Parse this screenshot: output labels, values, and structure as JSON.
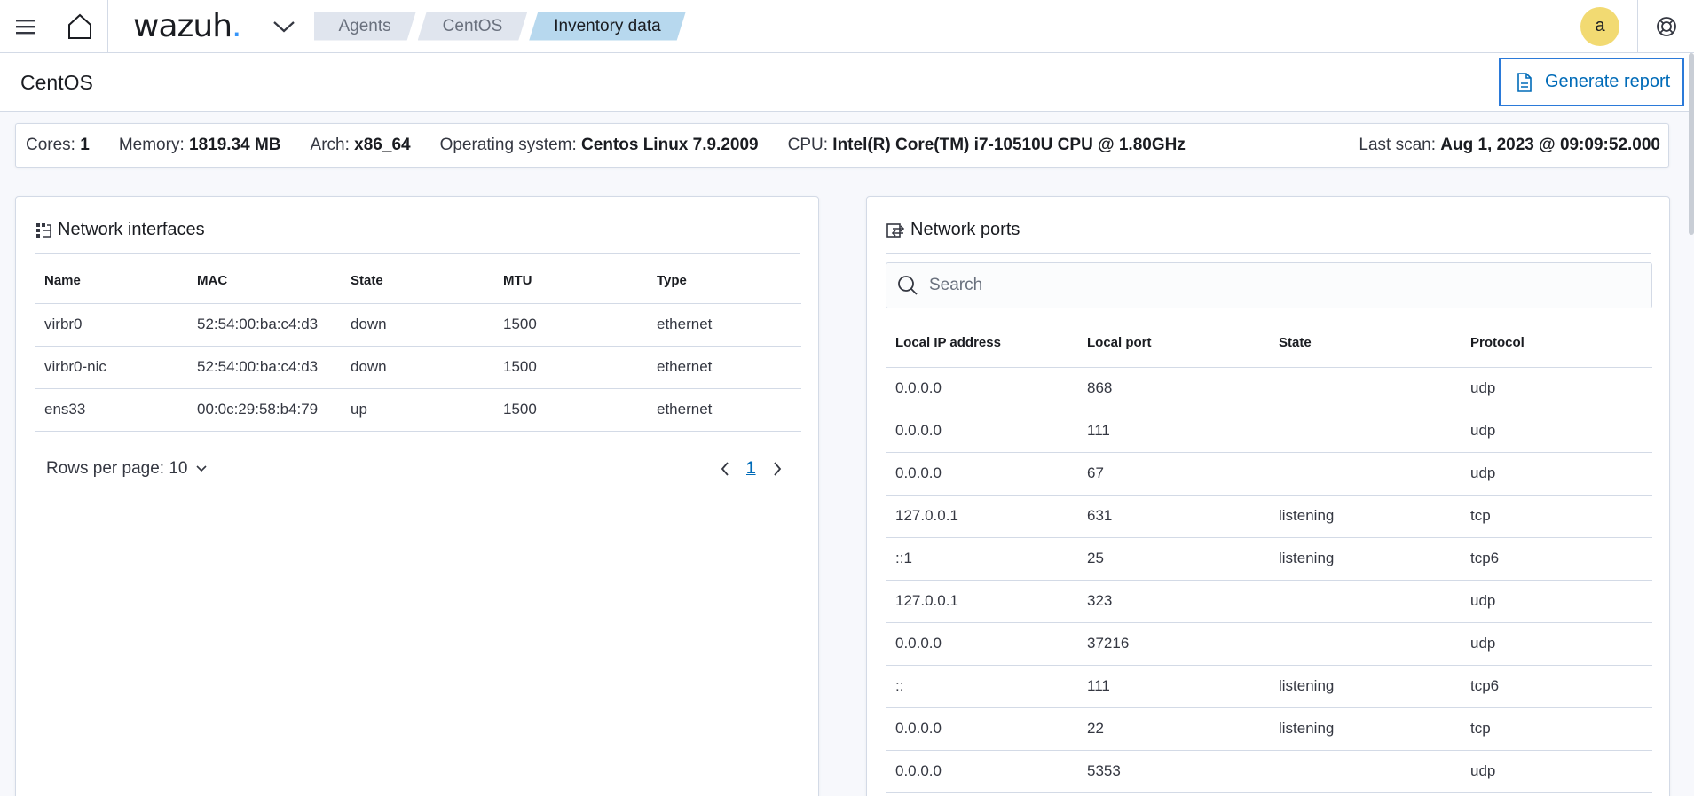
{
  "header": {
    "logo_text": "wazuh",
    "logo_dot": ".",
    "breadcrumbs": [
      "Agents",
      "CentOS",
      "Inventory data"
    ],
    "avatar_letter": "a"
  },
  "titlebar": {
    "title": "CentOS",
    "report_label": "Generate report"
  },
  "info": {
    "cores_label": "Cores:",
    "cores": "1",
    "memory_label": "Memory:",
    "memory": "1819.34 MB",
    "arch_label": "Arch:",
    "arch": "x86_64",
    "os_label": "Operating system:",
    "os": "Centos Linux 7.9.2009",
    "cpu_label": "CPU:",
    "cpu": "Intel(R) Core(TM) i7-10510U CPU @ 1.80GHz",
    "scan_label": "Last scan:",
    "scan": "Aug 1, 2023 @ 09:09:52.000"
  },
  "interfaces": {
    "title": "Network interfaces",
    "columns": [
      "Name",
      "MAC",
      "State",
      "MTU",
      "Type"
    ],
    "rows": [
      [
        "virbr0",
        "52:54:00:ba:c4:d3",
        "down",
        "1500",
        "ethernet"
      ],
      [
        "virbr0-nic",
        "52:54:00:ba:c4:d3",
        "down",
        "1500",
        "ethernet"
      ],
      [
        "ens33",
        "00:0c:29:58:b4:79",
        "up",
        "1500",
        "ethernet"
      ]
    ],
    "rows_per_page_label": "Rows per page: 10",
    "current_page": "1"
  },
  "ports": {
    "title": "Network ports",
    "search_placeholder": "Search",
    "columns": [
      "Local IP address",
      "Local port",
      "State",
      "Protocol"
    ],
    "rows": [
      [
        "0.0.0.0",
        "868",
        "",
        "udp"
      ],
      [
        "0.0.0.0",
        "111",
        "",
        "udp"
      ],
      [
        "0.0.0.0",
        "67",
        "",
        "udp"
      ],
      [
        "127.0.0.1",
        "631",
        "listening",
        "tcp"
      ],
      [
        "::1",
        "25",
        "listening",
        "tcp6"
      ],
      [
        "127.0.0.1",
        "323",
        "",
        "udp"
      ],
      [
        "0.0.0.0",
        "37216",
        "",
        "udp"
      ],
      [
        "::",
        "111",
        "listening",
        "tcp6"
      ],
      [
        "0.0.0.0",
        "22",
        "listening",
        "tcp"
      ],
      [
        "0.0.0.0",
        "5353",
        "",
        "udp"
      ]
    ]
  }
}
